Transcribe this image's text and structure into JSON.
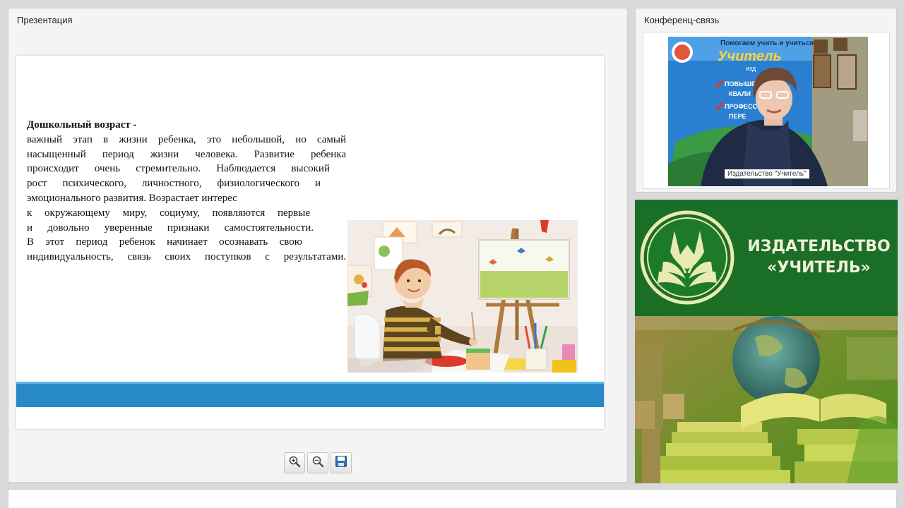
{
  "presentation": {
    "title": "Презентация",
    "slide": {
      "heading": "Дошкольный  возраст -",
      "lines": [
        "важный этап в жизни ребенка, это небольшой, но самый",
        " насыщенный период жизни человека. Развитие ребенка",
        "происходит очень стремительно. Наблюдается высокий",
        "рост психического, личностного, физиологического и",
        "эмоционального развития.  Возрастает  интерес",
        "к окружающему миру, социуму, появляются первые",
        "и довольно уверенные признаки самостоятельности.",
        "В этот период ребенок начинает осознавать свою",
        "индивидуальность, связь своих поступков с результатами."
      ],
      "accent_color": "#2889c9"
    },
    "toolbar": {
      "icons": [
        "zoom-in-icon",
        "zoom-out-icon",
        "save-icon"
      ]
    }
  },
  "conference": {
    "title": "Конференц-связь",
    "video": {
      "caption": "Издательство \"Учитель\"",
      "banner_lines": [
        "Помогаем учить и учиться",
        "Учитель",
        "изд",
        "ПОВЫШЕН",
        "КВАЛИ",
        "ПРОФЕСС",
        "ПЕРЕ"
      ]
    }
  },
  "publisher": {
    "line1": "ИЗДАТЕЛЬСТВО",
    "line2": "«УЧИТЕЛЬ»",
    "brand_color": "#1b6e25"
  }
}
